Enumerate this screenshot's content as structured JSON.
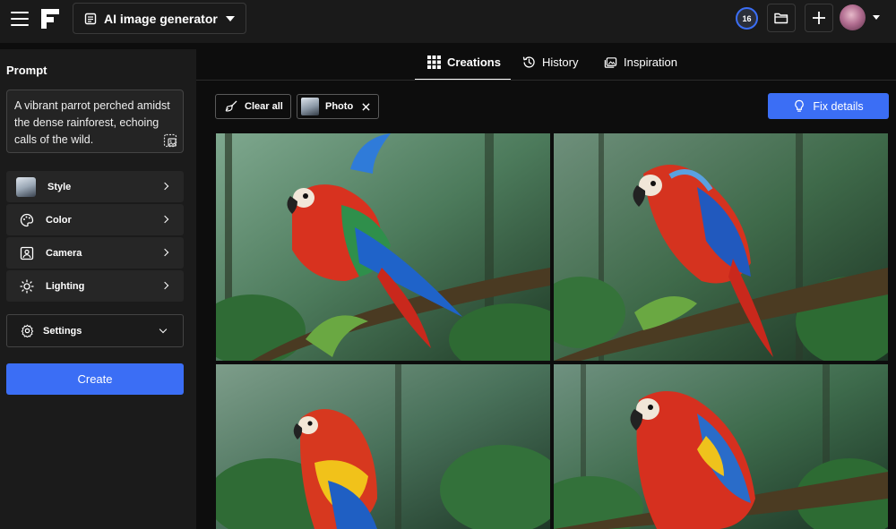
{
  "header": {
    "tool_select_label": "AI image generator",
    "credits": "16"
  },
  "left_panel": {
    "prompt_title": "Prompt",
    "prompt_text": "A vibrant parrot perched amidst the dense rainforest, echoing calls of the wild.",
    "menu": [
      {
        "label": "Style",
        "icon": "style-thumbnail"
      },
      {
        "label": "Color",
        "icon": "palette-icon"
      },
      {
        "label": "Camera",
        "icon": "camera-frame-icon"
      },
      {
        "label": "Lighting",
        "icon": "sun-icon"
      }
    ],
    "settings_label": "Settings",
    "create_label": "Create"
  },
  "main": {
    "tabs": [
      {
        "label": "Creations",
        "icon": "grid-icon",
        "active": true
      },
      {
        "label": "History",
        "icon": "history-icon",
        "active": false
      },
      {
        "label": "Inspiration",
        "icon": "inspiration-icon",
        "active": false
      }
    ],
    "clear_all_label": "Clear all",
    "filter_chip_label": "Photo",
    "fix_details_label": "Fix details"
  },
  "colors": {
    "accent": "#3b6ef5",
    "background": "#0d0d0d",
    "panel": "#1b1b1b"
  }
}
